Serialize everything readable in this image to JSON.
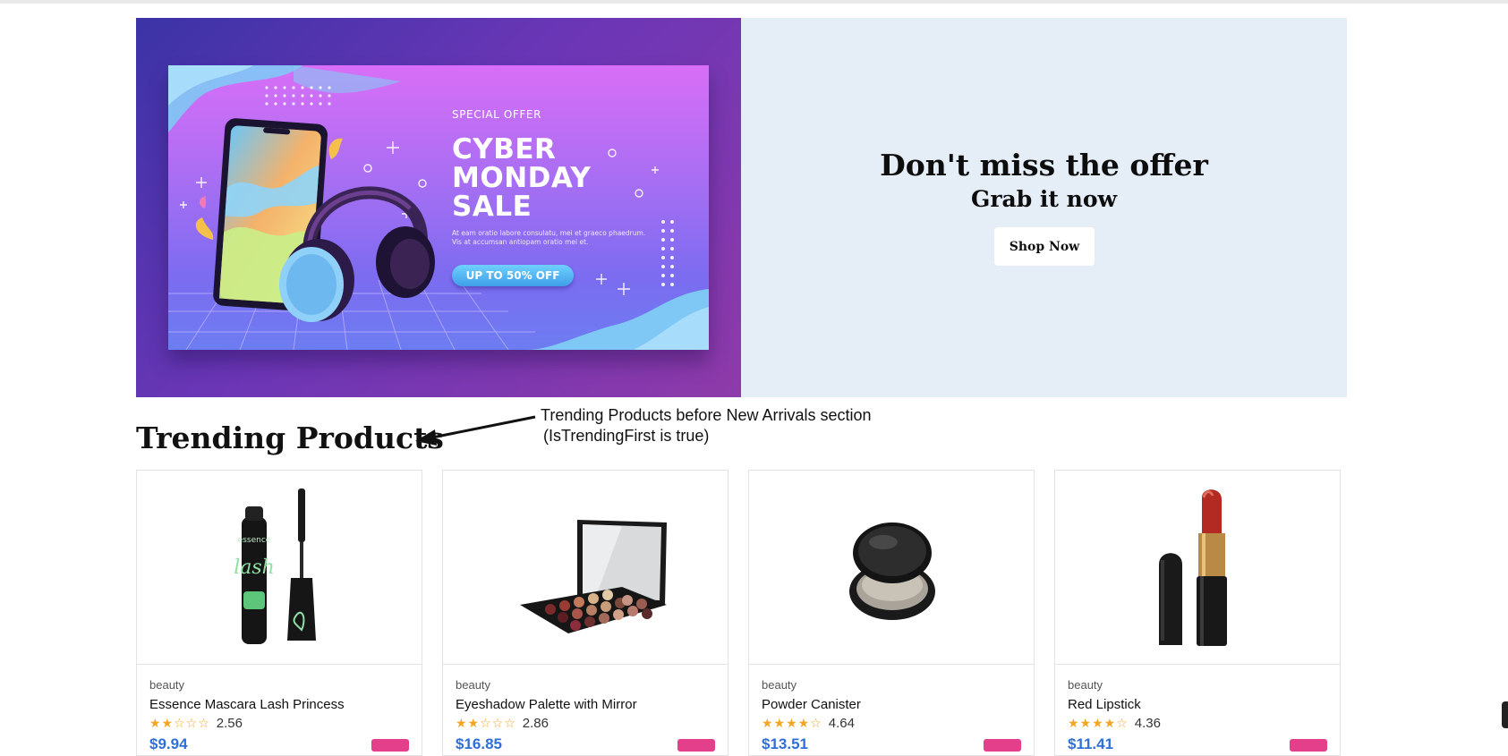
{
  "hero": {
    "promo": {
      "special_label": "SPECIAL OFFER",
      "headline": "CYBER MONDAY SALE",
      "description": "At eam oratio labore consulatu, mei et graeco phaedrum. Vis at accumsan antiopam oratio mei et.",
      "discount_label": "UP TO 50% OFF"
    },
    "title": "Don't miss the offer",
    "subtitle": "Grab it now",
    "cta_label": "Shop Now",
    "colors": {
      "panel_bg": "#e5edf7",
      "banner_accent": "#8e3aa9"
    }
  },
  "section": {
    "title": "Trending Products"
  },
  "annotation": {
    "line1": "Trending Products before New Arrivals section",
    "line2": "(IsTrendingFirst is true)"
  },
  "products": [
    {
      "category": "beauty",
      "name": "Essence Mascara Lash Princess",
      "rating": "2.56",
      "stars": 2.56,
      "price": "$9.94",
      "image": "mascara"
    },
    {
      "category": "beauty",
      "name": "Eyeshadow Palette with Mirror",
      "rating": "2.86",
      "stars": 2.86,
      "price": "$16.85",
      "image": "eyeshadow-palette"
    },
    {
      "category": "beauty",
      "name": "Powder Canister",
      "rating": "4.64",
      "stars": 4.64,
      "price": "$13.51",
      "image": "powder-compact"
    },
    {
      "category": "beauty",
      "name": "Red Lipstick",
      "rating": "4.36",
      "stars": 4.36,
      "price": "$11.41",
      "image": "lipstick"
    }
  ],
  "colors": {
    "star": "#f2a623",
    "price": "#2f6fd8",
    "badge": "#e33f8b"
  }
}
